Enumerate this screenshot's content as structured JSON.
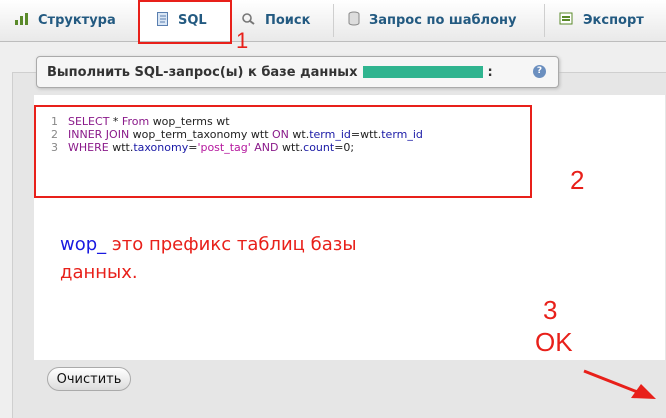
{
  "tabs": [
    {
      "label": "Структура",
      "icon": "structure-icon"
    },
    {
      "label": "SQL",
      "icon": "sql-icon",
      "active": true
    },
    {
      "label": "Поиск",
      "icon": "search-icon"
    },
    {
      "label": "Запрос по шаблону",
      "icon": "query-icon"
    },
    {
      "label": "Экспорт",
      "icon": "export-icon"
    }
  ],
  "panel": {
    "legend": "Выполнить SQL-запрос(ы) к базе данных",
    "legend_suffix": ":",
    "help_glyph": "?"
  },
  "editor": {
    "line_numbers": [
      "1",
      "2",
      "3"
    ],
    "lines": [
      "SELECT * From wop_terms wt",
      "INNER JOIN wop_term_taxonomy wtt ON wt.term_id=wtt.term_id",
      "WHERE wtt.taxonomy='post_tag' AND wtt.count=0;"
    ]
  },
  "annotations": {
    "marker_1": "1",
    "marker_2": "2",
    "marker_3": "3",
    "marker_ok": "OK",
    "note_prefix": "wop_",
    "note_line1": " это префикс таблиц базы",
    "note_line2": "данных."
  },
  "buttons": {
    "clear": "Очистить"
  },
  "colors": {
    "tab_text": "#235a81",
    "annotation": "#e8201a",
    "annotation_blue": "#1a1ae0",
    "sql_keyword": "#8a1a8a",
    "sql_identifier": "#1a1aa6",
    "sql_string": "#b5179e"
  }
}
